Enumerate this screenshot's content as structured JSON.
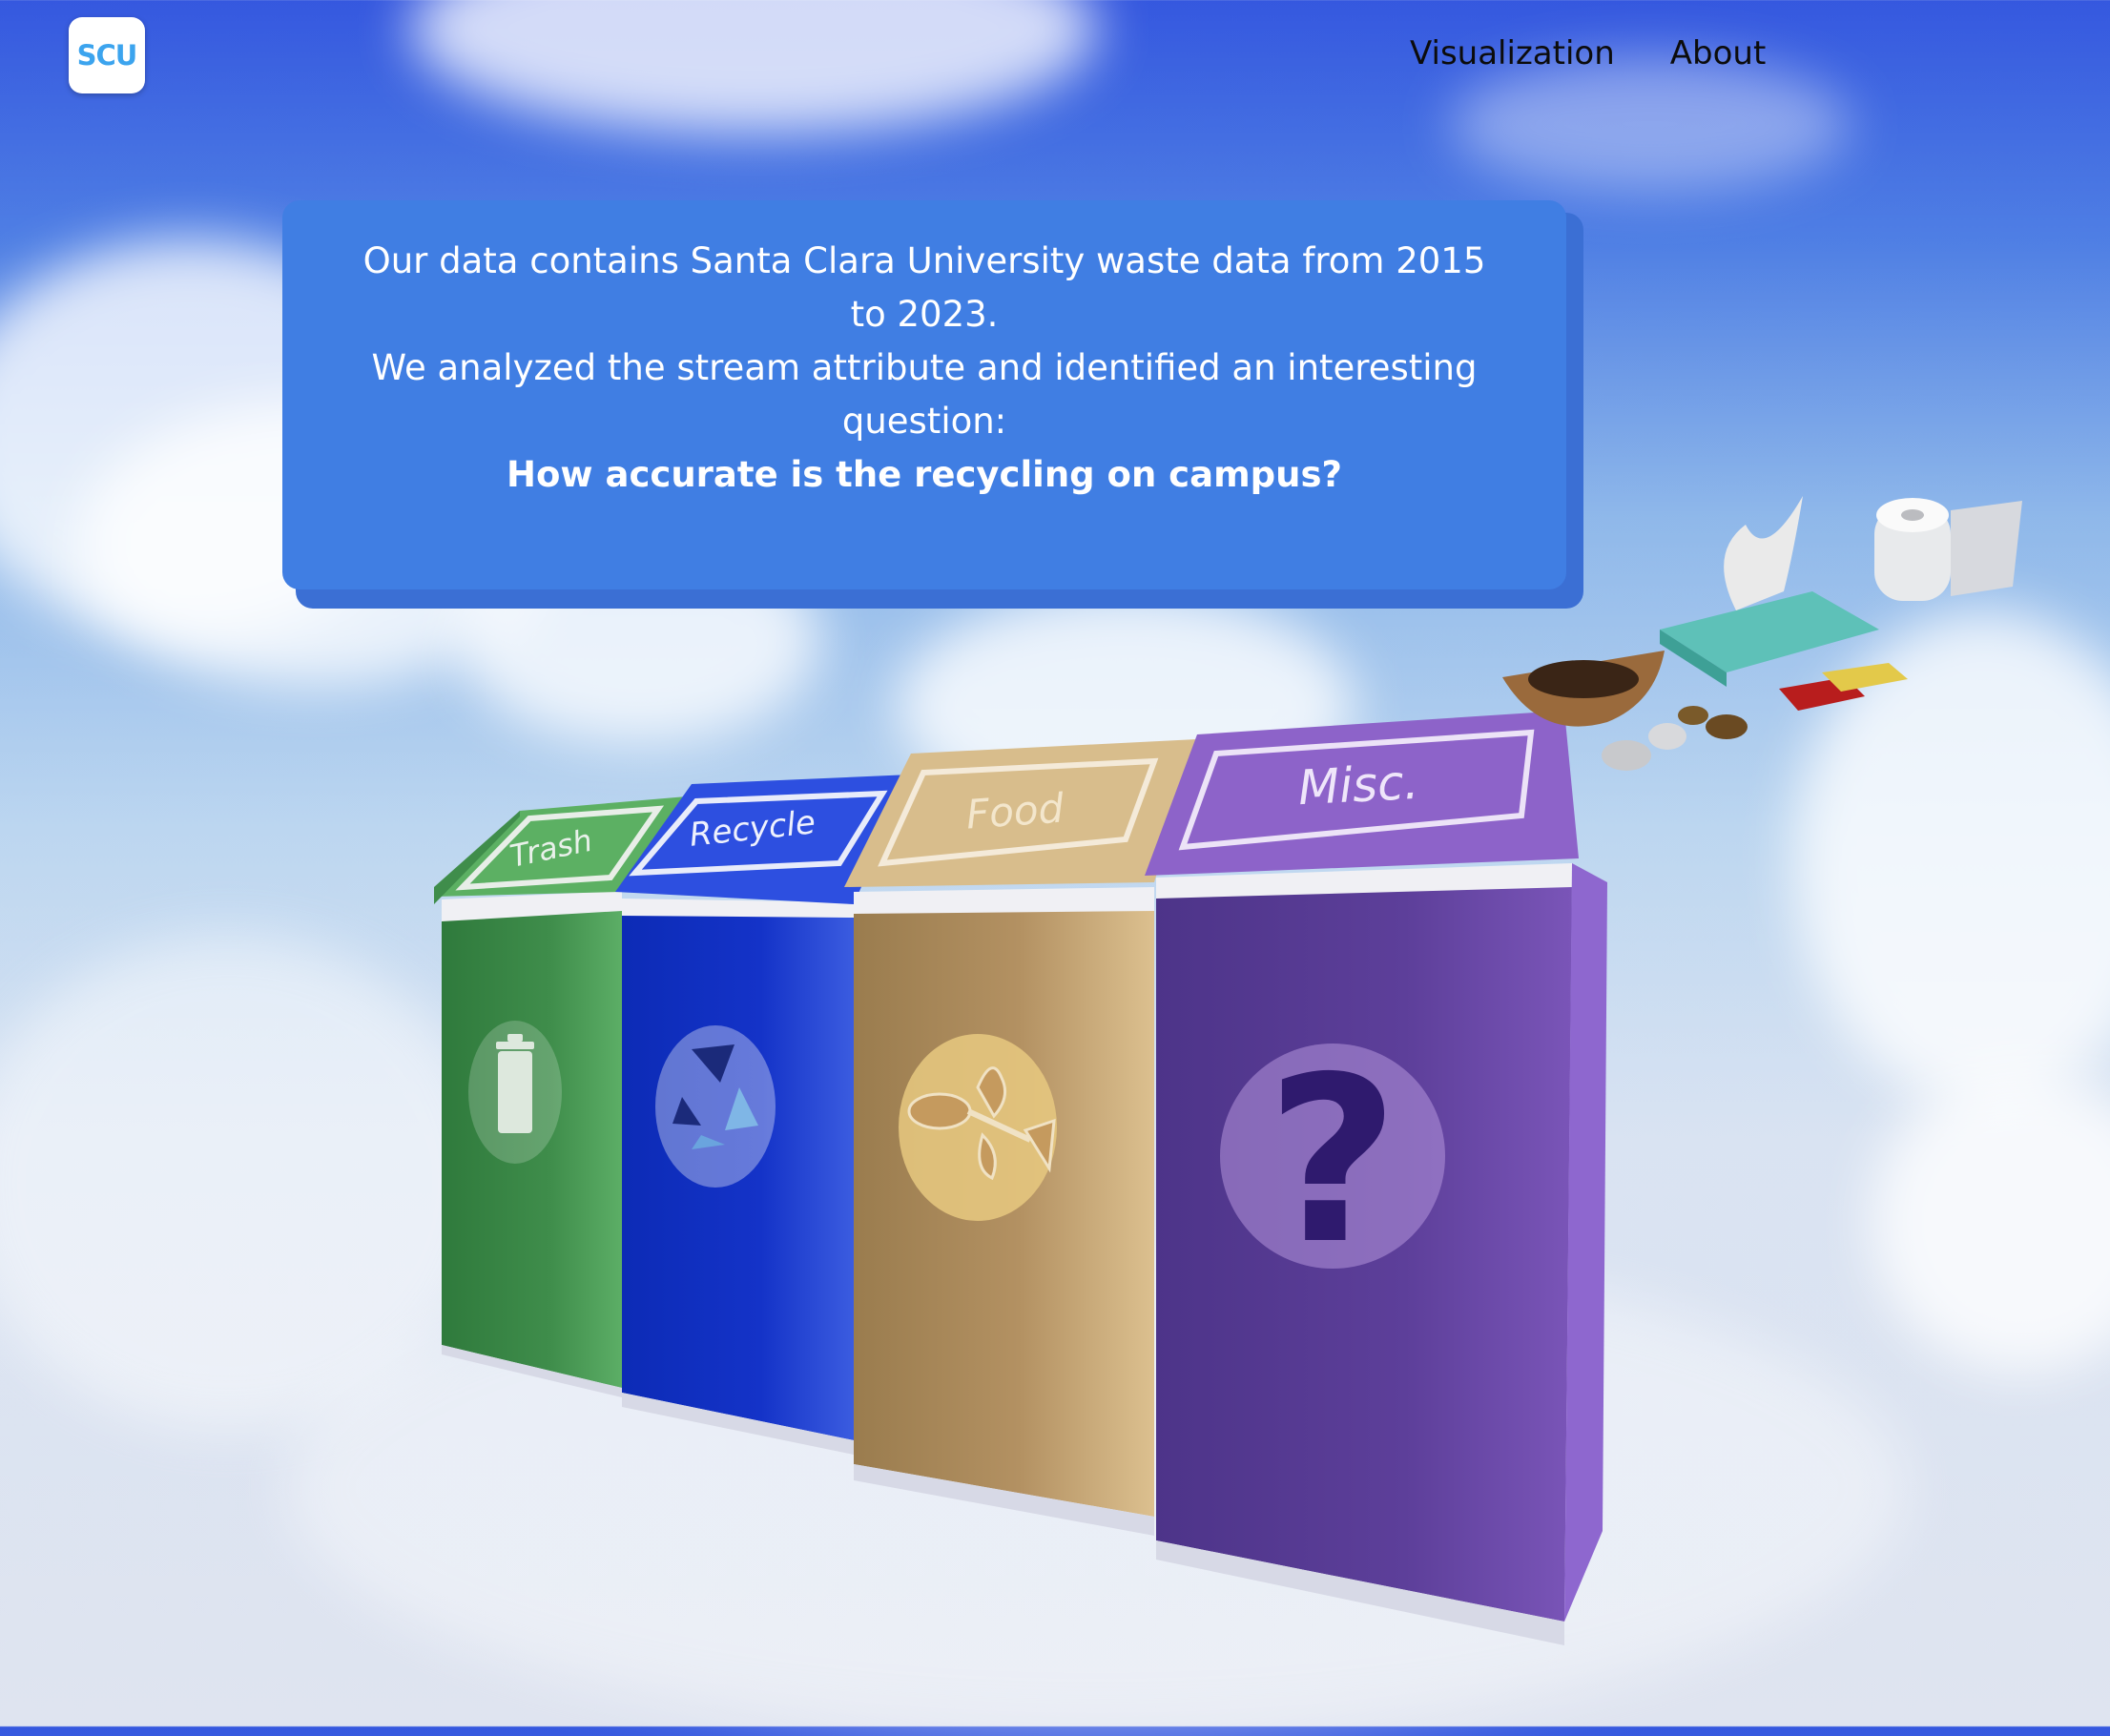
{
  "logo": {
    "text": "SCU"
  },
  "nav": {
    "items": [
      {
        "label": "Visualization"
      },
      {
        "label": "About"
      }
    ]
  },
  "intro": {
    "line1": "Our data contains Santa Clara University waste data from 2015 to 2023.",
    "line2": "We analyzed the stream attribute and identified an interesting question:",
    "question": "How accurate is the recycling on campus?"
  },
  "bins": {
    "trash": {
      "label": "Trash",
      "icon": "trash-can-icon"
    },
    "recycle": {
      "label": "Recycle",
      "icon": "recycle-icon"
    },
    "food": {
      "label": "Food",
      "icon": "fish-bone-icon"
    },
    "misc": {
      "label": "Misc.",
      "icon": "question-mark-icon"
    }
  },
  "colors": {
    "trash": "#3f8d4b",
    "recycle": "#1233c7",
    "food": "#c2a06f",
    "misc": "#5d3f9a",
    "panel": "#407ee3"
  }
}
